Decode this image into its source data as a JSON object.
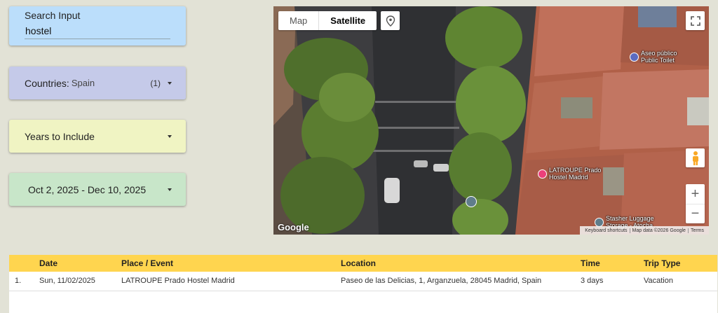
{
  "search": {
    "label": "Search Input",
    "value": "hostel"
  },
  "countries": {
    "label": "Countries:",
    "value": "Spain",
    "count": "(1)"
  },
  "years": {
    "label": "Years to Include"
  },
  "dates": {
    "label": "Oct 2, 2025 - Dec 10, 2025"
  },
  "map": {
    "type_map": "Map",
    "type_satellite": "Satellite",
    "zoom_in": "+",
    "zoom_out": "−",
    "google": "Google",
    "attribution": [
      "Keyboard shortcuts",
      "Map data ©2026 Google",
      "Terms"
    ],
    "pois": [
      {
        "label1": "Aseo público",
        "label2": "Public Toilet",
        "color": "#5c6bc0"
      },
      {
        "label1": "LATROUPE Prado",
        "label2": "Hostel Madrid",
        "color": "#ec407a"
      },
      {
        "label1": "Stasher Luggage",
        "label2": "Storage - Atocha",
        "color": "#607d8b"
      }
    ]
  },
  "table": {
    "headers": [
      "",
      "Date",
      "Place / Event",
      "Location",
      "Time",
      "Trip Type"
    ],
    "rows": [
      [
        "1.",
        "Sun, 11/02/2025",
        "LATROUPE Prado Hostel Madrid",
        "Paseo de las Delicias, 1, Arganzuela, 28045 Madrid, Spain",
        "3 days",
        "Vacation"
      ]
    ]
  }
}
